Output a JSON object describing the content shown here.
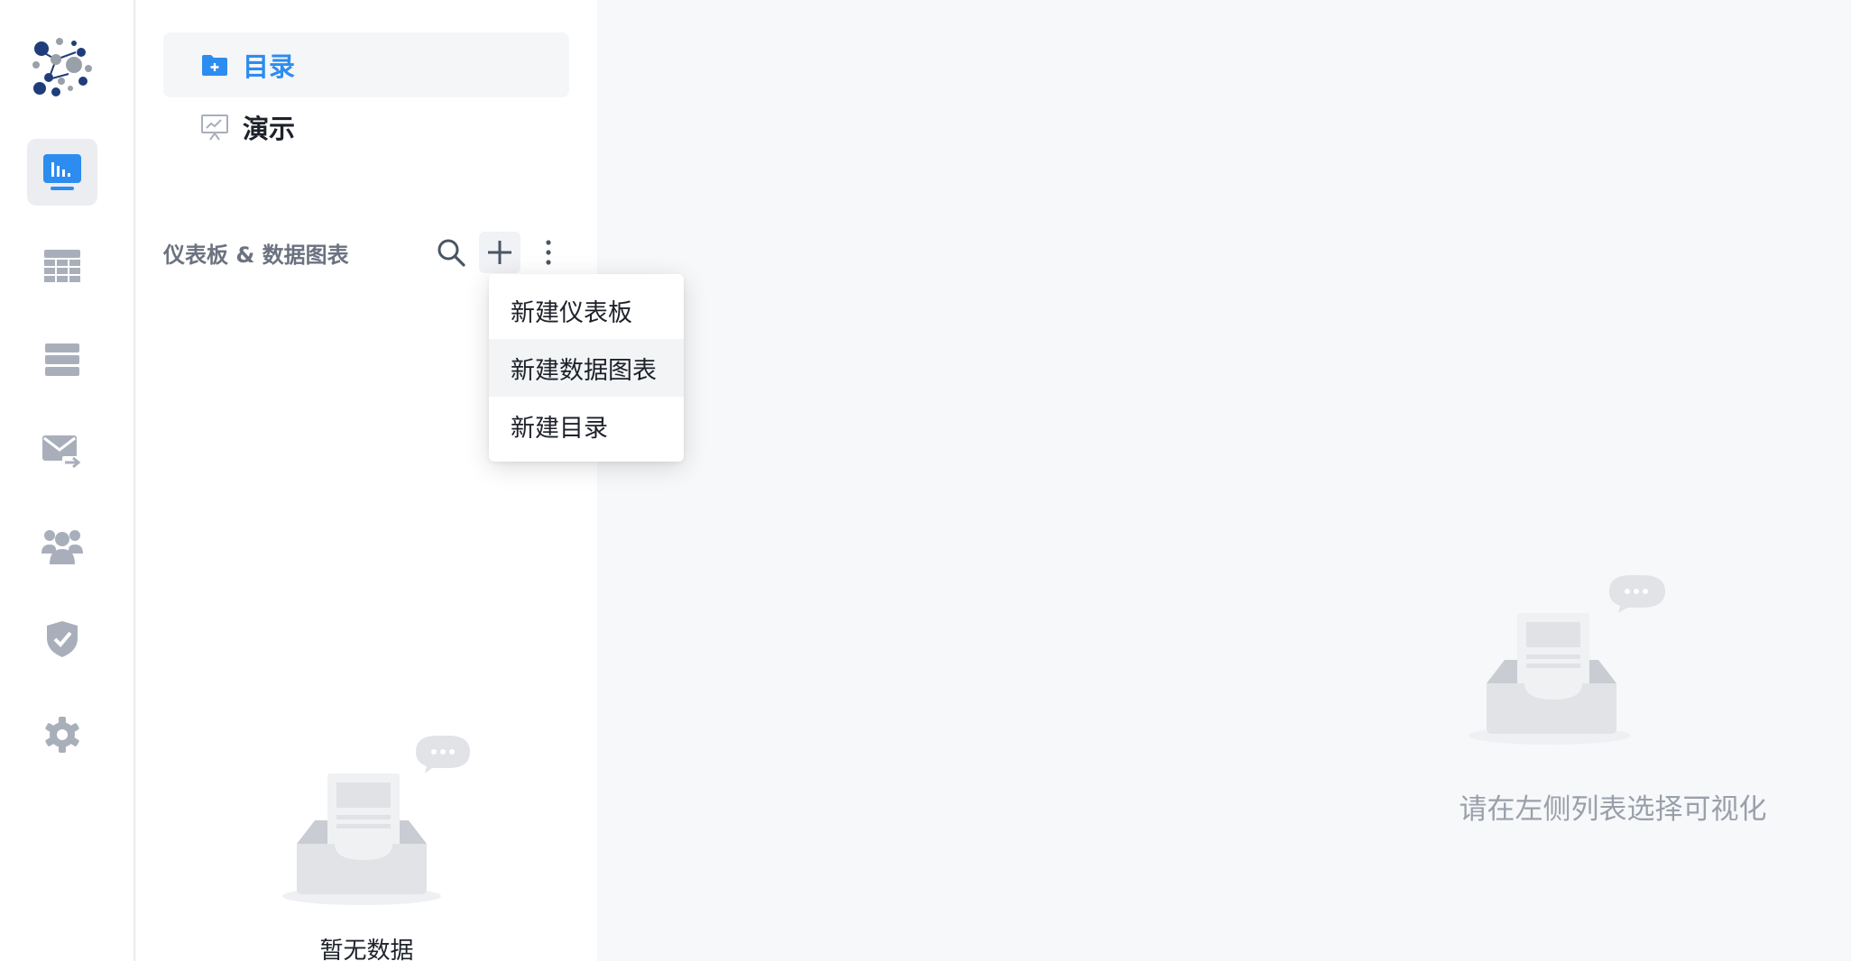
{
  "rail": {
    "items": [
      {
        "name": "dashboard",
        "icon": "dashboard-icon",
        "active": true
      },
      {
        "name": "table",
        "icon": "table-icon",
        "active": false
      },
      {
        "name": "datasource",
        "icon": "datasource-icon",
        "active": false
      },
      {
        "name": "schedule",
        "icon": "mail-forward-icon",
        "active": false
      },
      {
        "name": "members",
        "icon": "users-icon",
        "active": false
      },
      {
        "name": "permissions",
        "icon": "shield-check-icon",
        "active": false
      },
      {
        "name": "settings",
        "icon": "gear-icon",
        "active": false
      }
    ]
  },
  "sidebar": {
    "nav": [
      {
        "label": "目录",
        "icon": "folder-add-icon",
        "active": true
      },
      {
        "label": "演示",
        "icon": "presentation-icon",
        "active": false
      }
    ],
    "section_title": "仪表板 & 数据图表",
    "empty_text": "暂无数据"
  },
  "dropdown": {
    "items": [
      "新建仪表板",
      "新建数据图表",
      "新建目录"
    ],
    "hovered_index": 1
  },
  "main": {
    "empty_text": "请在左侧列表选择可视化"
  },
  "colors": {
    "accent": "#2d8cf0",
    "rail_icon": "#a9afba",
    "logo_dark": "#1f3d7a",
    "logo_gray": "#9aa0aa"
  }
}
